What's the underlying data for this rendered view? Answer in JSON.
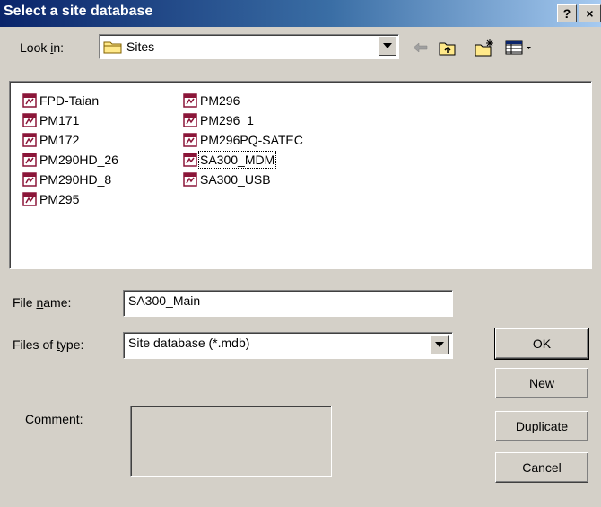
{
  "window": {
    "title": "Select a site database",
    "help_button": "?",
    "close_button": "×"
  },
  "lookin": {
    "label_pre": "Look ",
    "label_accel": "i",
    "label_post": "n:",
    "value": "Sites"
  },
  "files": {
    "col1": [
      "FPD-Taian",
      "PM171",
      "PM172",
      "PM290HD_26",
      "PM290HD_8",
      "PM295"
    ],
    "col2": [
      "PM296",
      "PM296_1",
      "PM296PQ-SATEC",
      "SA300_MDM",
      "SA300_USB"
    ],
    "focused": "SA300_MDM"
  },
  "filename": {
    "label_pre": "File ",
    "label_accel": "n",
    "label_post": "ame:",
    "value": "SA300_Main"
  },
  "filetype": {
    "label_pre": "Files of ",
    "label_accel": "t",
    "label_post": "ype:",
    "value": "Site database (*.mdb)"
  },
  "comment": {
    "label": "Comment:",
    "value": ""
  },
  "buttons": {
    "ok": "OK",
    "new": "New",
    "duplicate": "Duplicate",
    "cancel": "Cancel"
  },
  "colors": {
    "title_start": "#0a246a",
    "title_end": "#a6caf0",
    "face": "#d4d0c8"
  },
  "icons": [
    "folder-icon",
    "back-arrow-icon",
    "up-folder-icon",
    "new-folder-icon",
    "view-menu-icon",
    "mdb-file-icon"
  ]
}
